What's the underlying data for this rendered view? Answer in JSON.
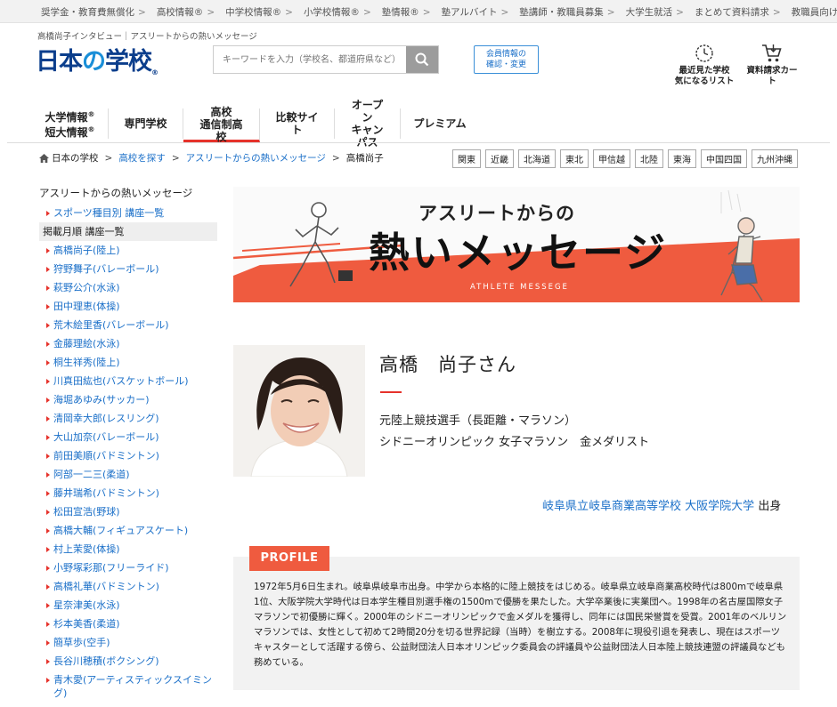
{
  "topnav": [
    {
      "label": "奨学金・教育費無償化"
    },
    {
      "label": "高校情報®"
    },
    {
      "label": "中学校情報®"
    },
    {
      "label": "小学校情報®"
    },
    {
      "label": "塾情報®"
    },
    {
      "label": "塾アルバイト"
    },
    {
      "label": "塾講師・教職員募集"
    },
    {
      "label": "大学生就活"
    },
    {
      "label": "まとめて資料請求"
    },
    {
      "label": "教職員向け"
    }
  ],
  "header": {
    "tagline": "高橋尚子インタビュー｜アスリートからの熱いメッセージ",
    "logo": {
      "part1": "日本",
      "part2": "の",
      "part3": "学校",
      "mark": "®"
    },
    "search_placeholder": "キーワードを入力（学校名、都道府県など）",
    "member_line1": "会員情報の",
    "member_line2": "確認・変更",
    "recent_line1": "最近見た学校",
    "recent_line2": "気になるリスト",
    "cart_label": "資料請求カート"
  },
  "mainnav": [
    {
      "line1": "大学情報",
      "line2": "短大情報"
    },
    {
      "line1": "専門学校",
      "line2": ""
    },
    {
      "line1": "高校",
      "line2": "通信制高校"
    },
    {
      "line1": "比較サイト",
      "line2": ""
    },
    {
      "line1": "オープン",
      "line2": "キャンパス"
    },
    {
      "line1": "プレミアム",
      "line2": ""
    }
  ],
  "breadcrumb": {
    "home": "日本の学校",
    "b2": "高校を探す",
    "b3": "アスリートからの熱いメッセージ",
    "current": "高橋尚子"
  },
  "regions": [
    "関東",
    "近畿",
    "北海道",
    "東北",
    "甲信越",
    "北陸",
    "東海",
    "中国四国",
    "九州沖縄"
  ],
  "sidebar": {
    "title": "アスリートからの熱いメッセージ",
    "items": [
      "スポーツ種目別 講座一覧",
      "掲載月順 講座一覧",
      "高橋尚子(陸上)",
      "狩野舞子(バレーボール)",
      "萩野公介(水泳)",
      "田中理恵(体操)",
      "荒木絵里香(バレーボール)",
      "金藤理絵(水泳)",
      "桐生祥秀(陸上)",
      "川真田紘也(バスケットボール)",
      "海堀あゆみ(サッカー)",
      "清岡幸大郎(レスリング)",
      "大山加奈(バレーボール)",
      "前田美順(バドミントン)",
      "阿部一二三(柔道)",
      "藤井瑞希(バドミントン)",
      "松田宣浩(野球)",
      "高橋大輔(フィギュアスケート)",
      "村上茉愛(体操)",
      "小野塚彩那(フリーライド)",
      "高橋礼華(バドミントン)",
      "星奈津美(水泳)",
      "杉本美香(柔道)",
      "簡草歩(空手)",
      "長谷川穂積(ボクシング)",
      "青木愛(アーティスティックスイミング)"
    ]
  },
  "banner": {
    "line1": "アスリートからの",
    "line2": "熱いメッセージ",
    "sub": "ATHLETE MESSEGE"
  },
  "profile": {
    "name": "高橋　尚子さん",
    "desc1": "元陸上競技選手（長距離・マラソン）",
    "desc2": "シドニーオリンピック 女子マラソン　金メダリスト",
    "school1": "岐阜県立岐阜商業高等学校",
    "school2": "大阪学院大学",
    "school_suffix": "出身",
    "tag": "PROFILE",
    "text": "1972年5月6日生まれ。岐阜県岐阜市出身。中学から本格的に陸上競技をはじめる。岐阜県立岐阜商業高校時代は800mで岐阜県1位、大阪学院大学時代は日本学生種目別選手権の1500mで優勝を果たした。大学卒業後に実業団へ。1998年の名古屋国際女子マラソンで初優勝に輝く。2000年のシドニーオリンピックで金メダルを獲得し、同年には国民栄誉賞を受賞。2001年のベルリンマラソンでは、女性として初めて2時間20分を切る世界記録（当時）を樹立する。2008年に現役引退を発表し、現在はスポーツキャスターとして活躍する傍ら、公益財団法人日本オリンピック委員会の評議員や公益財団法人日本陸上競技連盟の評議員なども務めている。"
  },
  "colors": {
    "brand": "#0b3e8c",
    "accent": "#e6322b",
    "link": "#1a6fc8",
    "profile_tag": "#ef5b3f"
  }
}
